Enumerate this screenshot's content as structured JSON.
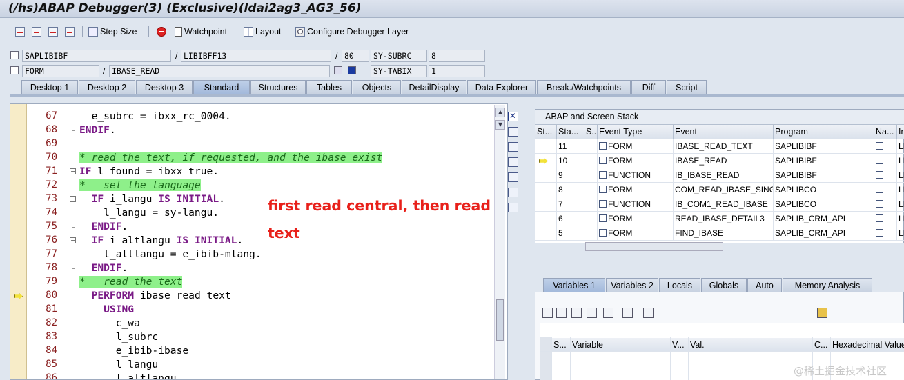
{
  "window": {
    "title": "(/hs)ABAP Debugger(3)  (Exclusive)(ldai2ag3_AG3_56)"
  },
  "toolbar": {
    "buttons": [
      {
        "label": "",
        "icon": "single-step-icon"
      },
      {
        "label": "",
        "icon": "execute-icon"
      },
      {
        "label": "",
        "icon": "return-icon"
      },
      {
        "label": "",
        "icon": "continue-icon"
      },
      {
        "label": "Step Size",
        "icon": "step-size-icon"
      },
      {
        "label": "",
        "icon": "stop-icon"
      },
      {
        "label": "Watchpoint",
        "icon": "watchpoint-icon"
      },
      {
        "label": "Layout",
        "icon": "layout-icon"
      },
      {
        "label": "Configure Debugger Layer",
        "icon": "configure-icon"
      }
    ]
  },
  "fields": {
    "program": "SAPLIBIBF",
    "include": "LIBIBFF13",
    "line": "80",
    "sy_subrc_label": "SY-SUBRC",
    "sy_subrc_value": "8",
    "proc_type": "FORM",
    "proc_name": "IBASE_READ",
    "sy_tabix_label": "SY-TABIX",
    "sy_tabix_value": "1",
    "slash": "/"
  },
  "tabs": [
    "Desktop 1",
    "Desktop 2",
    "Desktop 3",
    "Standard",
    "Structures",
    "Tables",
    "Objects",
    "DetailDisplay",
    "Data Explorer",
    "Break./Watchpoints",
    "Diff",
    "Script"
  ],
  "active_tab": "Standard",
  "code_lines": [
    {
      "n": "67",
      "text": "  e_subrc = ibxx_rc_0004."
    },
    {
      "n": "68",
      "text": "ENDIF."
    },
    {
      "n": "69",
      "text": ""
    },
    {
      "n": "70",
      "text": "* read the text, if requested, and the ibase exist"
    },
    {
      "n": "71",
      "text": "IF l_found = ibxx_true."
    },
    {
      "n": "72",
      "text": "*   set the language"
    },
    {
      "n": "73",
      "text": "  IF i_langu IS INITIAL."
    },
    {
      "n": "74",
      "text": "    l_langu = sy-langu."
    },
    {
      "n": "75",
      "text": "  ENDIF."
    },
    {
      "n": "76",
      "text": "  IF i_altlangu IS INITIAL."
    },
    {
      "n": "77",
      "text": "    l_altlangu = e_ibib-mlang."
    },
    {
      "n": "78",
      "text": "  ENDIF."
    },
    {
      "n": "79",
      "text": "*   read the text"
    },
    {
      "n": "80",
      "text": "  PERFORM ibase_read_text"
    },
    {
      "n": "81",
      "text": "    USING"
    },
    {
      "n": "82",
      "text": "      c_wa"
    },
    {
      "n": "83",
      "text": "      l_subrc"
    },
    {
      "n": "84",
      "text": "      e_ibib-ibase"
    },
    {
      "n": "85",
      "text": "      l_langu"
    },
    {
      "n": "86",
      "text": "      l_altlangu"
    }
  ],
  "annotation": "first read central, then read\ntext",
  "stack": {
    "title": "ABAP and Screen Stack",
    "columns": [
      "St...",
      "Sta...",
      "S...",
      "Event Type",
      "Event",
      "Program",
      "Na...",
      "In"
    ],
    "rows": [
      {
        "level": "11",
        "type": "FORM",
        "event": "IBASE_READ_TEXT",
        "program": "SAPLIBIBF",
        "inc": "LI",
        "current": false
      },
      {
        "level": "10",
        "type": "FORM",
        "event": "IBASE_READ",
        "program": "SAPLIBIBF",
        "inc": "LI",
        "current": true
      },
      {
        "level": "9",
        "type": "FUNCTION",
        "event": "IB_IBASE_READ",
        "program": "SAPLIBIBF",
        "inc": "LI",
        "current": false
      },
      {
        "level": "8",
        "type": "FORM",
        "event": "COM_READ_IBASE_SING...",
        "program": "SAPLIBCO",
        "inc": "LI",
        "current": false
      },
      {
        "level": "7",
        "type": "FUNCTION",
        "event": "IB_COM1_READ_IBASE",
        "program": "SAPLIBCO",
        "inc": "LI",
        "current": false
      },
      {
        "level": "6",
        "type": "FORM",
        "event": "READ_IBASE_DETAIL3",
        "program": "SAPLIB_CRM_API",
        "inc": "LI",
        "current": false
      },
      {
        "level": "5",
        "type": "FORM",
        "event": "FIND_IBASE",
        "program": "SAPLIB_CRM_API",
        "inc": "LI",
        "current": false
      }
    ]
  },
  "var_tabs": [
    "Variables 1",
    "Variables 2",
    "Locals",
    "Globals",
    "Auto",
    "Memory Analysis"
  ],
  "active_var_tab": "Variables 1",
  "var_columns": [
    "S...",
    "Variable",
    "V...",
    "Val.",
    "C...",
    "Hexadecimal Value"
  ],
  "watermark": "@稀土掘金技术社区"
}
